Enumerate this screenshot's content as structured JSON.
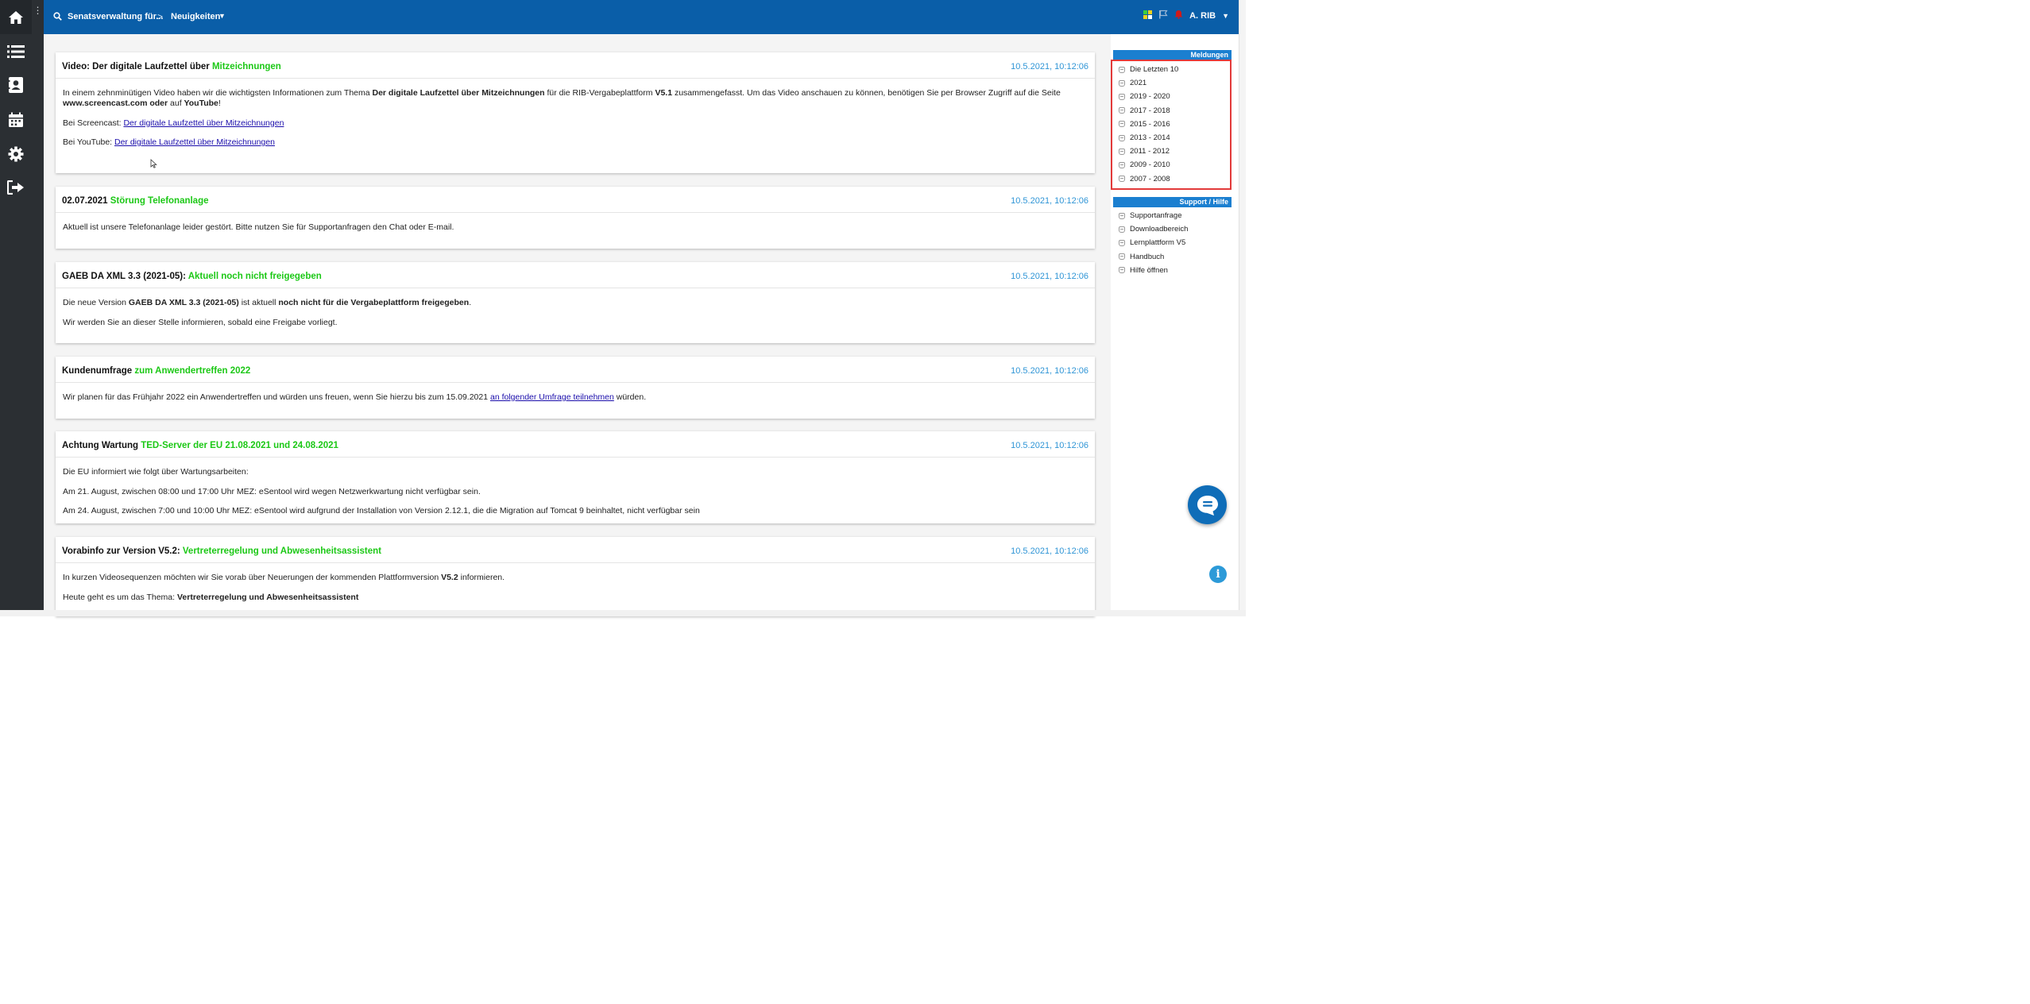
{
  "topbar": {
    "breadcrumb_1": "Senatsverwaltung für...",
    "breadcrumb_sep": ">",
    "breadcrumb_2": "Neuigkeiten",
    "user_name": "A. RIB"
  },
  "sidebar": {
    "items": [
      "home-icon",
      "list-icon",
      "contacts-icon",
      "calendar-icon",
      "settings-icon",
      "logout-icon"
    ]
  },
  "news": [
    {
      "title": "Video: Der digitale Laufzettel über ",
      "title_accent": "Mitzeichnungen",
      "date": "10.5.2021, 10:12:06",
      "p1_a": "In einem zehnminütigen Video haben wir die wichtigsten Informationen zum Thema ",
      "p1_b": "Der digitale Laufzettel über Mitzeichnungen",
      "p1_c": " für die RIB-Vergabeplattform ",
      "p1_d": "V5.1",
      "p1_e": " zusammengefasst. Um das Video anschauen zu können, benötigen Sie per Browser Zugriff auf die Seite ",
      "p1_f": "www.screencast.com oder",
      "p1_g": " auf ",
      "p1_h": "YouTube",
      "p1_i": "!",
      "p2_label": "Bei Screencast: ",
      "p2_link": "Der digitale Laufzettel über Mitzeichnungen",
      "p3_label": "Bei YouTube: ",
      "p3_link": "Der digitale Laufzettel über Mitzeichnungen"
    },
    {
      "title": "02.07.2021 ",
      "title_accent": "Störung Telefonanlage",
      "date": "10.5.2021, 10:12:06",
      "p1": "Aktuell ist unsere Telefonanlage leider gestört. Bitte nutzen Sie für Supportanfragen den Chat oder E-mail."
    },
    {
      "title": "GAEB DA XML 3.3 (2021-05): ",
      "title_accent": "Aktuell noch nicht freigegeben",
      "date": "10.5.2021, 10:12:06",
      "p1_a": "Die neue Version ",
      "p1_b": "GAEB DA XML 3.3 (2021-05)",
      "p1_c": " ist aktuell ",
      "p1_d": "noch nicht für die Vergabeplattform freigegeben",
      "p1_e": ".",
      "p2": "Wir werden Sie an dieser Stelle informieren, sobald eine Freigabe vorliegt."
    },
    {
      "title": "Kundenumfrage ",
      "title_accent": "zum Anwendertreffen 2022",
      "date": "10.5.2021, 10:12:06",
      "p1_a": "Wir planen für das Frühjahr 2022 ein Anwendertreffen und würden uns freuen, wenn Sie hierzu bis zum 15.09.2021 ",
      "p1_link": "an folgender Umfrage teilnehmen",
      "p1_b": " würden."
    },
    {
      "title": "Achtung Wartung ",
      "title_accent": "TED-Server der EU 21.08.2021 und 24.08.2021",
      "date": "10.5.2021, 10:12:06",
      "p1": "Die EU informiert wie folgt über Wartungsarbeiten:",
      "p2": "Am 21. August, zwischen 08:00 und 17:00 Uhr MEZ: eSentool wird wegen Netzwerkwartung nicht verfügbar sein.",
      "p3": "Am 24. August, zwischen 7:00 und 10:00 Uhr MEZ: eSentool wird aufgrund der Installation von Version 2.12.1, die die Migration auf Tomcat 9 beinhaltet, nicht verfügbar sein"
    },
    {
      "title": "Vorabinfo zur Version V5.2: ",
      "title_accent": "Vertreterregelung und Abwesenheitsassistent",
      "date": "10.5.2021, 10:12:06",
      "p1_a": "In kurzen Videosequenzen möchten wir Sie vorab über Neuerungen der kommenden Plattformversion ",
      "p1_b": "V5.2",
      "p1_c": " informieren.",
      "p2_a": "Heute geht es um das Thema: ",
      "p2_b": "Vertreterregelung und Abwesenheitsassistent"
    }
  ],
  "right_panel": {
    "meldungen_header": "Meldungen",
    "meldungen": [
      "Die Letzten 10",
      "2021",
      "2019 - 2020",
      "2017 - 2018",
      "2015 - 2016",
      "2013 - 2014",
      "2011 - 2012",
      "2009 - 2010",
      "2007 - 2008"
    ],
    "support_header": "Support / Hilfe",
    "support": [
      "Supportanfrage",
      "Downloadbereich",
      "Lernplattform V5",
      "Handbuch",
      "Hilfe öffnen"
    ]
  },
  "colors": {
    "topbar": "#0a5ea8",
    "sidebar": "#2b2f33",
    "accent_green": "#1cc816",
    "date_blue": "#2f95d6",
    "highlight_red": "#e23a3a"
  }
}
